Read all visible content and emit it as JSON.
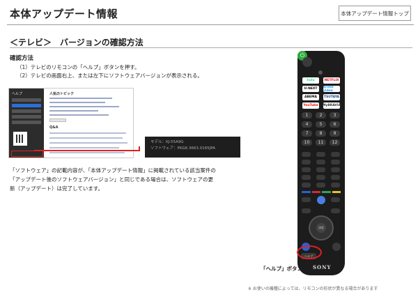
{
  "header": {
    "title": "本体アップデート情報",
    "top_button": "本体アップデート情報トップ"
  },
  "section": {
    "title": "＜テレビ＞　バージョンの確認方法"
  },
  "steps": {
    "heading": "確認方法",
    "items": [
      "（1）テレビのリモコンの「ヘルプ」ボタンを押す。",
      "（2）テレビの画面右上、または左下にソフトウェアバージョンが表示される。"
    ]
  },
  "help_screen": {
    "sidebar_title": "ヘルプ",
    "main_title": "人気のトピック",
    "qa_title": "Q&A"
  },
  "version_callout": {
    "lines": [
      "モデル：KJ-55A9G",
      "ソフトウェア：PKG6.3663.0165JPA"
    ]
  },
  "explanation": "「ソフトウェア」の記載内容が、「本体アップデート情報」に掲載されている該当案件の「アップデート後のソフトウェアバージョン」と同じである場合は、ソフトウェアの更新（アップデート）は完了しています。",
  "remote": {
    "apps": [
      "hulu",
      "NETFLIX",
      "U-NEXT",
      "prime video",
      "ABEMA",
      "TSUTAYA",
      "YouTube",
      "MyBRAVIA"
    ],
    "numbers": [
      "1",
      "2",
      "3",
      "4",
      "5",
      "6",
      "7",
      "8",
      "9",
      "10",
      "11",
      "12"
    ],
    "dpad_label": "決定",
    "help_key": "ヘルプ",
    "brand": "SONY",
    "colors": [
      "#2b5fd1",
      "#d32a2a",
      "#2ea44f",
      "#e6c21d"
    ]
  },
  "callouts": {
    "help_button_label": "「ヘルプ」ボタン"
  },
  "footnote": "※ お使いの機種によっては、リモコンの形状が異なる場合があります"
}
